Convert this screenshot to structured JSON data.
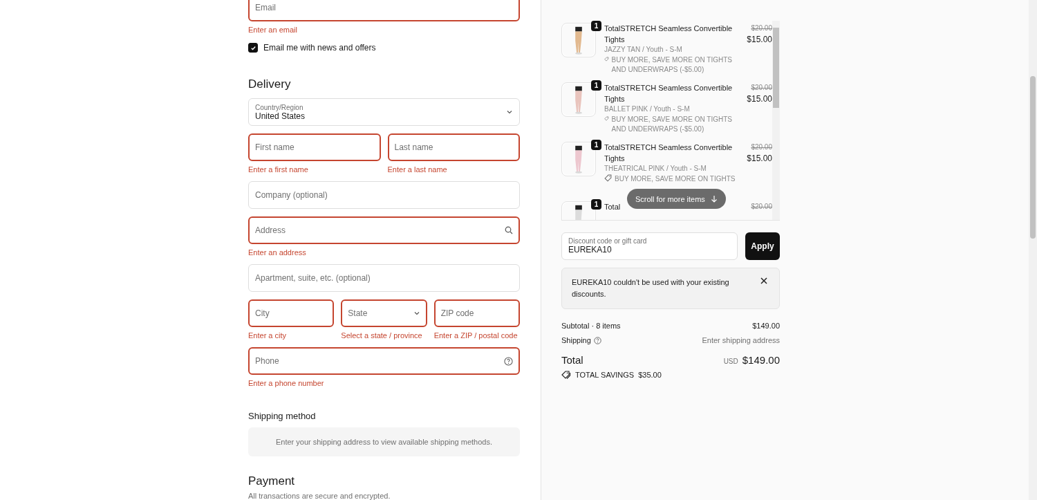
{
  "contact": {
    "email": {
      "placeholder": "Email",
      "invalid": true,
      "error": "Enter an email"
    },
    "newsletter": {
      "label": "Email me with news and offers",
      "checked": true
    }
  },
  "delivery": {
    "title": "Delivery",
    "rows": [
      [
        {
          "kind": "select",
          "label": "Country/Region",
          "value": "United States",
          "invalid": false
        }
      ],
      [
        {
          "kind": "text",
          "placeholder": "First name",
          "invalid": true,
          "error": "Enter a first name"
        },
        {
          "kind": "text",
          "placeholder": "Last name",
          "invalid": true,
          "error": "Enter a last name"
        }
      ],
      [
        {
          "kind": "text",
          "placeholder": "Company (optional)",
          "invalid": false
        }
      ],
      [
        {
          "kind": "search",
          "placeholder": "Address",
          "invalid": true,
          "error": "Enter an address"
        }
      ],
      [
        {
          "kind": "text",
          "placeholder": "Apartment, suite, etc. (optional)",
          "invalid": false
        }
      ],
      [
        {
          "kind": "text",
          "placeholder": "City",
          "invalid": true,
          "error": "Enter a city"
        },
        {
          "kind": "select",
          "placeholder": "State",
          "invalid": true,
          "error": "Select a state / province"
        },
        {
          "kind": "text",
          "placeholder": "ZIP code",
          "invalid": true,
          "error": "Enter a ZIP / postal code"
        }
      ],
      [
        {
          "kind": "help",
          "placeholder": "Phone",
          "invalid": true,
          "error": "Enter a phone number"
        }
      ]
    ]
  },
  "shipping_method": {
    "title": "Shipping method",
    "notice": "Enter your shipping address to view available shipping methods."
  },
  "payment": {
    "title": "Payment",
    "subtitle": "All transactions are secure and encrypted."
  },
  "cart": {
    "items": [
      {
        "quantity": "1",
        "title": "TotalSTRETCH Seamless Convertible Tights",
        "variant": "JAZZY TAN / Youth - S-M",
        "discount": "BUY MORE, SAVE MORE ON TIGHTS AND UNDERWRAPS (-$5.00)",
        "old_price": "$20.00",
        "price": "$15.00",
        "color": "#e2b98f"
      },
      {
        "quantity": "1",
        "title": "TotalSTRETCH Seamless Convertible Tights",
        "variant": "BALLET PINK / Youth - S-M",
        "discount": "BUY MORE, SAVE MORE ON TIGHTS AND UNDERWRAPS (-$5.00)",
        "old_price": "$20.00",
        "price": "$15.00",
        "color": "#e9c4bd"
      },
      {
        "quantity": "1",
        "title": "TotalSTRETCH Seamless Convertible Tights",
        "variant": "THEATRICAL PINK / Youth - S-M",
        "discount": "BUY MORE, SAVE MORE ON TIGHTS",
        "old_price": "$20.00",
        "price": "$15.00",
        "color": "#edc7cf"
      },
      {
        "quantity": "1",
        "title": "Total",
        "old_price": "$20.00",
        "color": "#dcdcdc"
      }
    ],
    "scroll_hint": "Scroll for more items"
  },
  "discount": {
    "label": "Discount code or gift card",
    "value": "EUREKA10",
    "button": "Apply",
    "alert": "EUREKA10 couldn't be used with your existing discounts."
  },
  "summary": {
    "subtotal_label": "Subtotal · 8 items",
    "subtotal": "$149.00",
    "shipping_label": "Shipping",
    "shipping": "Enter shipping address",
    "total_label": "Total",
    "currency": "USD",
    "total": "$149.00",
    "savings_label": "TOTAL SAVINGS",
    "savings": "$35.00"
  }
}
